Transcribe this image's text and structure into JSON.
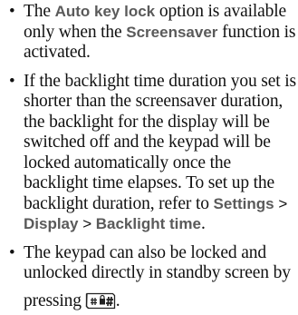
{
  "notes": {
    "item1": {
      "pre": "The ",
      "ui1": "Auto key lock",
      "mid": " option is available only when the ",
      "ui2": "Screensaver",
      "post": " function is activated."
    },
    "item2": {
      "text": "If the backlight time duration you set is shorter than the screensaver duration, the backlight for the display will be switched off and the keypad will be locked automatically once the backlight time elapses. To set up the backlight duration, refer to ",
      "path1": "Settings",
      "sep1": ">",
      "path2": "Display",
      "sep2": ">",
      "path3": "Backlight time",
      "end": "."
    },
    "item3": {
      "text": "The keypad can also be locked and unlocked directly in standby screen by",
      "pressing": "pressing",
      "key_icon": "hash-key-lock-icon",
      "end": "."
    }
  }
}
